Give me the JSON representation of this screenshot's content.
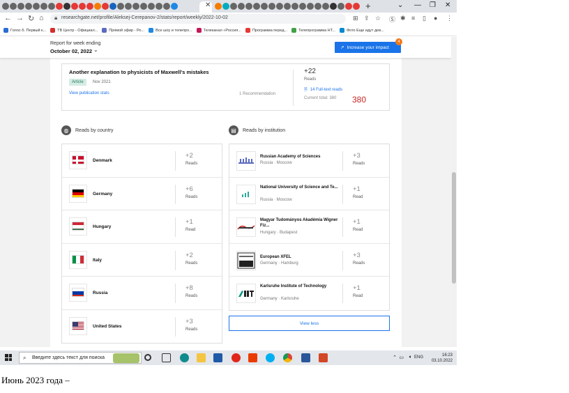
{
  "browser": {
    "url": "researchgate.net/profile/Aleksej-Cerepanov-2/stats/report/weekly/2022-10-02",
    "bookmarks": [
      {
        "label": "Голос-5. Первый к...",
        "color": "#2b6cd4"
      },
      {
        "label": "ТВ Центр - Официал...",
        "color": "#d32f2f"
      },
      {
        "label": "Прямой эфир - Ро...",
        "color": "#5c6bc0"
      },
      {
        "label": "Все шоу и телепро...",
        "color": "#1e88e5"
      },
      {
        "label": "Телеканал «Россия...",
        "color": "#c2185b"
      },
      {
        "label": "Программа перед...",
        "color": "#e53935"
      },
      {
        "label": "Телепрограмма НТ...",
        "color": "#43a047"
      },
      {
        "label": "Фото Еще идут дев...",
        "color": "#0288d1"
      }
    ]
  },
  "header": {
    "report_label": "Report for week ending",
    "report_date": "October 02, 2022",
    "impact_button": "Increase your impact",
    "impact_badge": "4"
  },
  "publication": {
    "title": "Another explanation to physicists of Maxwell's mistakes",
    "type": "Article",
    "date": "Nov 2021",
    "stats_link": "View publication stats",
    "recommendations": "1 Recommendation",
    "reads_delta": "+22",
    "reads_label": "Reads",
    "fulltext_reads": "14 Full-text reads",
    "current_total_label": "Current total: 380",
    "current_total": "380"
  },
  "sections": {
    "by_country": "Reads by country",
    "by_institution": "Reads by institution"
  },
  "countries": [
    {
      "name": "Denmark",
      "reads": "+2",
      "unit": "Reads"
    },
    {
      "name": "Germany",
      "reads": "+6",
      "unit": "Reads"
    },
    {
      "name": "Hungary",
      "reads": "+1",
      "unit": "Read"
    },
    {
      "name": "Italy",
      "reads": "+2",
      "unit": "Reads"
    },
    {
      "name": "Russia",
      "reads": "+8",
      "unit": "Reads"
    },
    {
      "name": "United States",
      "reads": "+3",
      "unit": "Reads"
    }
  ],
  "institutions": [
    {
      "name": "Russian Academy of Sciences",
      "location": "Russia · Moscow",
      "reads": "+3",
      "unit": "Reads"
    },
    {
      "name": "National University of Science and Te...",
      "location": "Russia · Moscow",
      "reads": "+1",
      "unit": "Read"
    },
    {
      "name": "Magyar Tudományos Akadémia Wigner Fiz...",
      "location": "Hungary · Budapest",
      "reads": "+1",
      "unit": "Read"
    },
    {
      "name": "European XFEL",
      "location": "Germany · Hamburg",
      "reads": "+3",
      "unit": "Reads"
    },
    {
      "name": "Karlsruhe Institute of Technology",
      "location": "Germany · Karlsruhe",
      "reads": "+1",
      "unit": "Read"
    }
  ],
  "view_less": "View less",
  "taskbar": {
    "search_placeholder": "Введите здесь текст для поиска",
    "lang": "ENG",
    "time": "16:23",
    "date": "03.10.2022"
  },
  "caption": "Июнь 2023 года –",
  "colors": {
    "accent": "#1a73e8",
    "total_red": "#c62828",
    "badge_orange": "#f07a1c"
  }
}
